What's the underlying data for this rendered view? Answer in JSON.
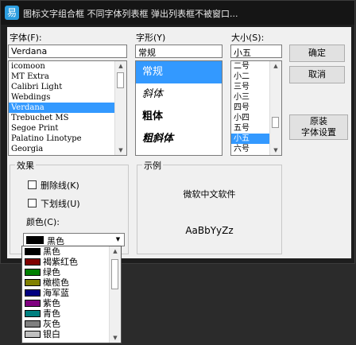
{
  "window": {
    "title": "图标文字组合框 不同字体列表框 弹出列表框不被窗口..."
  },
  "font": {
    "label": "字体(F):",
    "value": "Verdana",
    "items": [
      "icomoon",
      "MT Extra",
      "Calibri Light",
      "Webdings",
      "Verdana",
      "Trebuchet MS",
      "Segoe Print",
      "Palatino Linotype",
      "Georgia"
    ],
    "selected": "Verdana"
  },
  "style": {
    "label": "字形(Y)",
    "value": "常规",
    "items": [
      "常规",
      "斜体",
      "粗体",
      "粗斜体"
    ],
    "selected": "常规"
  },
  "size": {
    "label": "大小(S):",
    "value": "小五",
    "items": [
      "二号",
      "小二",
      "三号",
      "小三",
      "四号",
      "小四",
      "五号",
      "小五",
      "六号"
    ],
    "selected": "小五"
  },
  "buttons": {
    "ok": "确定",
    "cancel": "取消",
    "original": "原装\n字体设置"
  },
  "effects": {
    "title": "效果",
    "strikeout": "删除线(K)",
    "underline": "下划线(U)",
    "color_label": "颜色(C):",
    "color_value": "黑色",
    "color_swatch": "#000000"
  },
  "sample": {
    "title": "示例",
    "text1": "微软中文软件",
    "text2": "AaBbYyZz"
  },
  "color_dropdown": {
    "items": [
      {
        "label": "黑色",
        "color": "#000000"
      },
      {
        "label": "褐紫红色",
        "color": "#800000"
      },
      {
        "label": "绿色",
        "color": "#008000"
      },
      {
        "label": "橄榄色",
        "color": "#808000"
      },
      {
        "label": "海军蓝",
        "color": "#000080"
      },
      {
        "label": "紫色",
        "color": "#800080"
      },
      {
        "label": "青色",
        "color": "#008080"
      },
      {
        "label": "灰色",
        "color": "#808080"
      },
      {
        "label": "银白",
        "color": "#c0c0c0"
      }
    ],
    "selected": "黑色"
  }
}
